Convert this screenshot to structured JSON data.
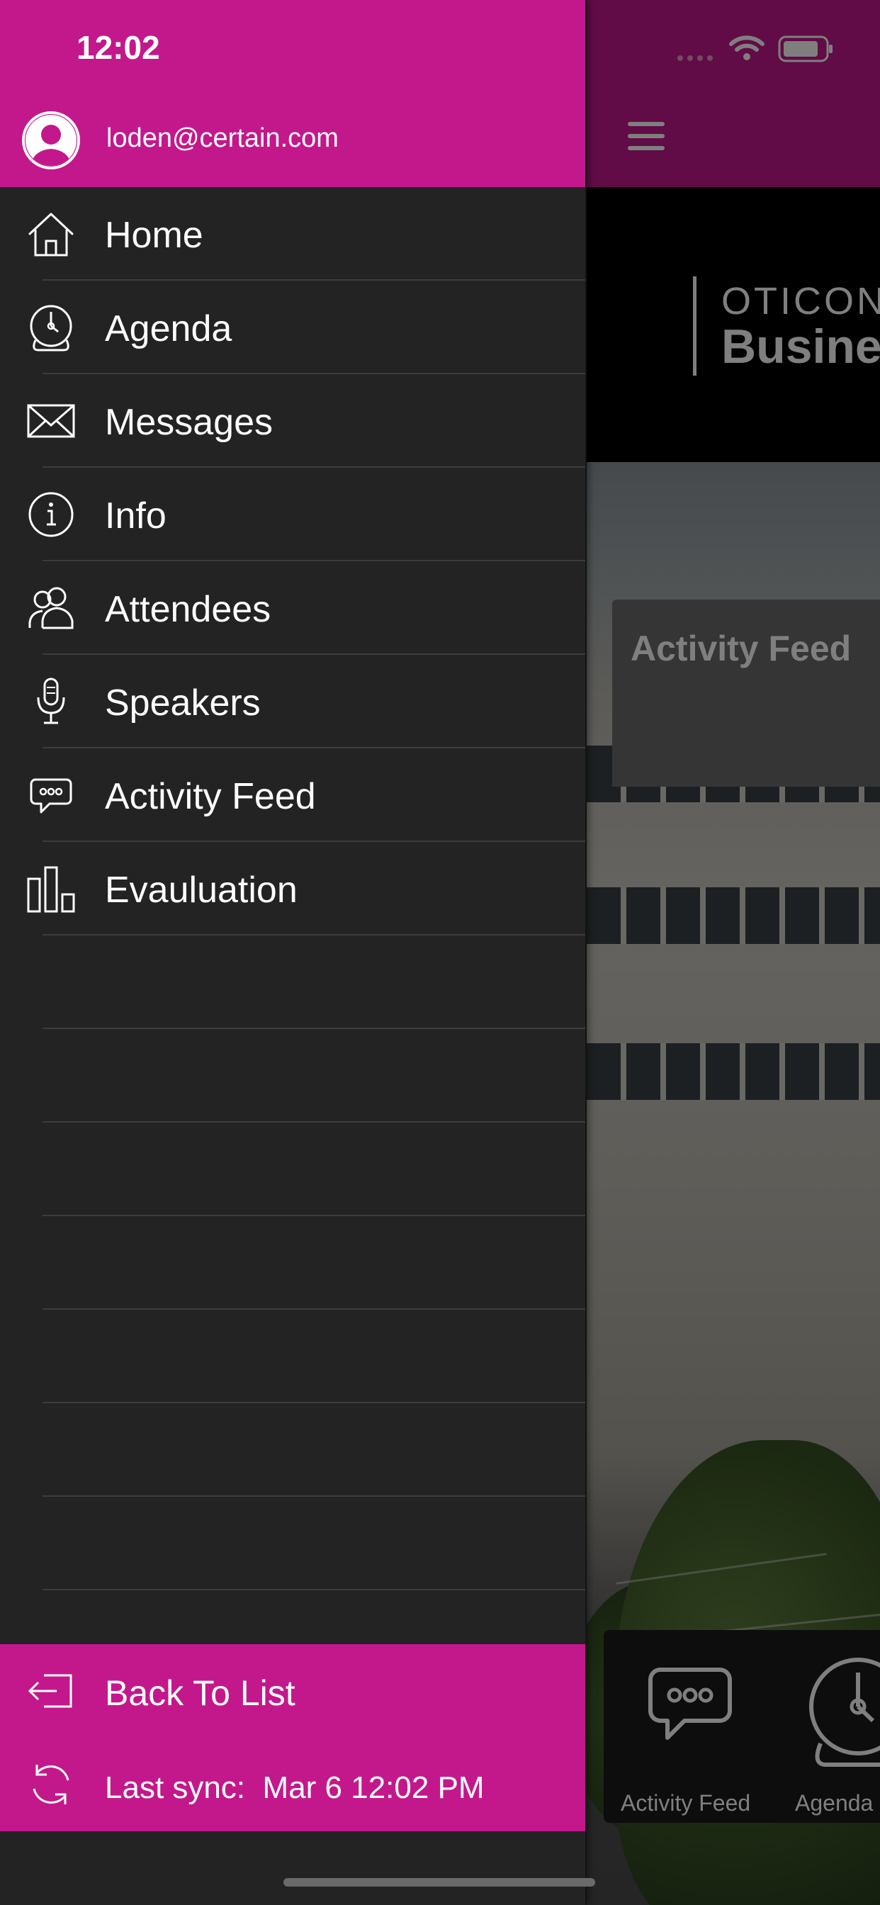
{
  "status_bar": {
    "time": "12:02"
  },
  "user": {
    "email": "loden@certain.com"
  },
  "menu": {
    "items": [
      {
        "label": "Home",
        "icon": "home-icon"
      },
      {
        "label": "Agenda",
        "icon": "clock-icon"
      },
      {
        "label": "Messages",
        "icon": "envelope-icon"
      },
      {
        "label": "Info",
        "icon": "info-icon"
      },
      {
        "label": "Attendees",
        "icon": "people-icon"
      },
      {
        "label": "Speakers",
        "icon": "microphone-icon"
      },
      {
        "label": "Activity Feed",
        "icon": "chat-bubble-icon"
      },
      {
        "label": "Evauluation",
        "icon": "bar-chart-icon"
      }
    ]
  },
  "footer": {
    "back_label": "Back To List",
    "sync_label": "Last sync:  Mar 6 12:02 PM"
  },
  "main": {
    "brand_line1": "OTICON",
    "brand_line2": "Business",
    "feed_card_title": "Activity Feed",
    "tiles": [
      {
        "label": "Activity Feed",
        "icon": "chat-bubble-icon"
      },
      {
        "label": "Agenda",
        "icon": "clock-icon"
      }
    ]
  },
  "colors": {
    "accent": "#c3188c",
    "drawer_bg": "#232323",
    "separator": "#3c3c3c"
  }
}
